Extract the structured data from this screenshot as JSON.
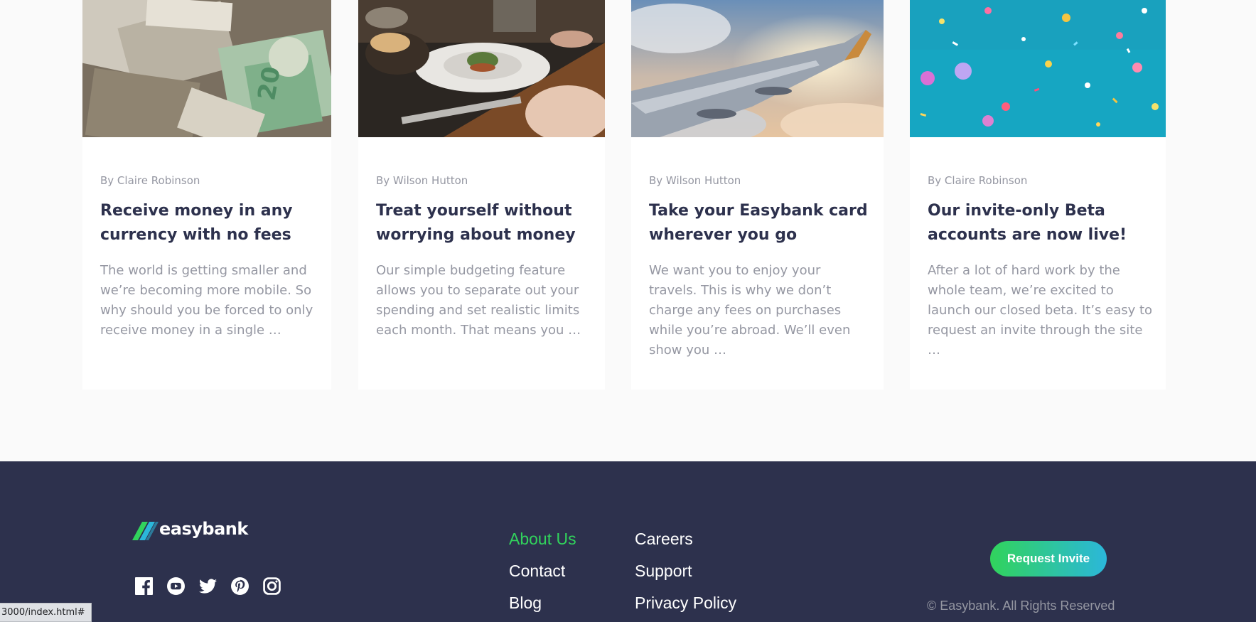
{
  "articles": [
    {
      "author": "By Claire Robinson",
      "title": "Receive money in any currency with no fees",
      "excerpt": "The world is getting smaller and we’re becoming more mobile. So why should you be forced to only receive money in a single …",
      "image": "currency-image"
    },
    {
      "author": "By Wilson Hutton",
      "title": "Treat yourself without worrying about money",
      "excerpt": "Our simple budgeting feature allows you to separate out your spending and set realistic limits each month. That means you …",
      "image": "restaurant-image"
    },
    {
      "author": "By Wilson Hutton",
      "title": "Take your Easybank card wherever you go",
      "excerpt": "We want you to enjoy your travels. This is why we don’t charge any fees on purchases while you’re abroad. We’ll even show you …",
      "image": "plane-image"
    },
    {
      "author": "By Claire Robinson",
      "title": "Our invite-only Beta accounts are now live!",
      "excerpt": "After a lot of hard work by the whole team, we’re excited to launch our closed beta. It’s easy to request an invite through the site …",
      "image": "confetti-image"
    }
  ],
  "footer": {
    "logo_text": "easybank",
    "social_icons": [
      "facebook-icon",
      "youtube-icon",
      "twitter-icon",
      "pinterest-icon",
      "instagram-icon"
    ],
    "links": [
      {
        "label": "About Us",
        "active": true
      },
      {
        "label": "Contact",
        "active": false
      },
      {
        "label": "Blog",
        "active": false
      },
      {
        "label": "Careers",
        "active": false
      },
      {
        "label": "Support",
        "active": false
      },
      {
        "label": "Privacy Policy",
        "active": false
      }
    ],
    "cta_label": "Request Invite",
    "copyright": "© Easybank. All Rights Reserved"
  },
  "status_bar": {
    "url": "3000/index.html#"
  },
  "colors": {
    "dark_blue": "#2d314d",
    "lime_green": "#31d35c",
    "bright_cyan": "#2bb7da",
    "grayish_blue": "#9597a2",
    "light_gray_bg": "#fafafa"
  }
}
